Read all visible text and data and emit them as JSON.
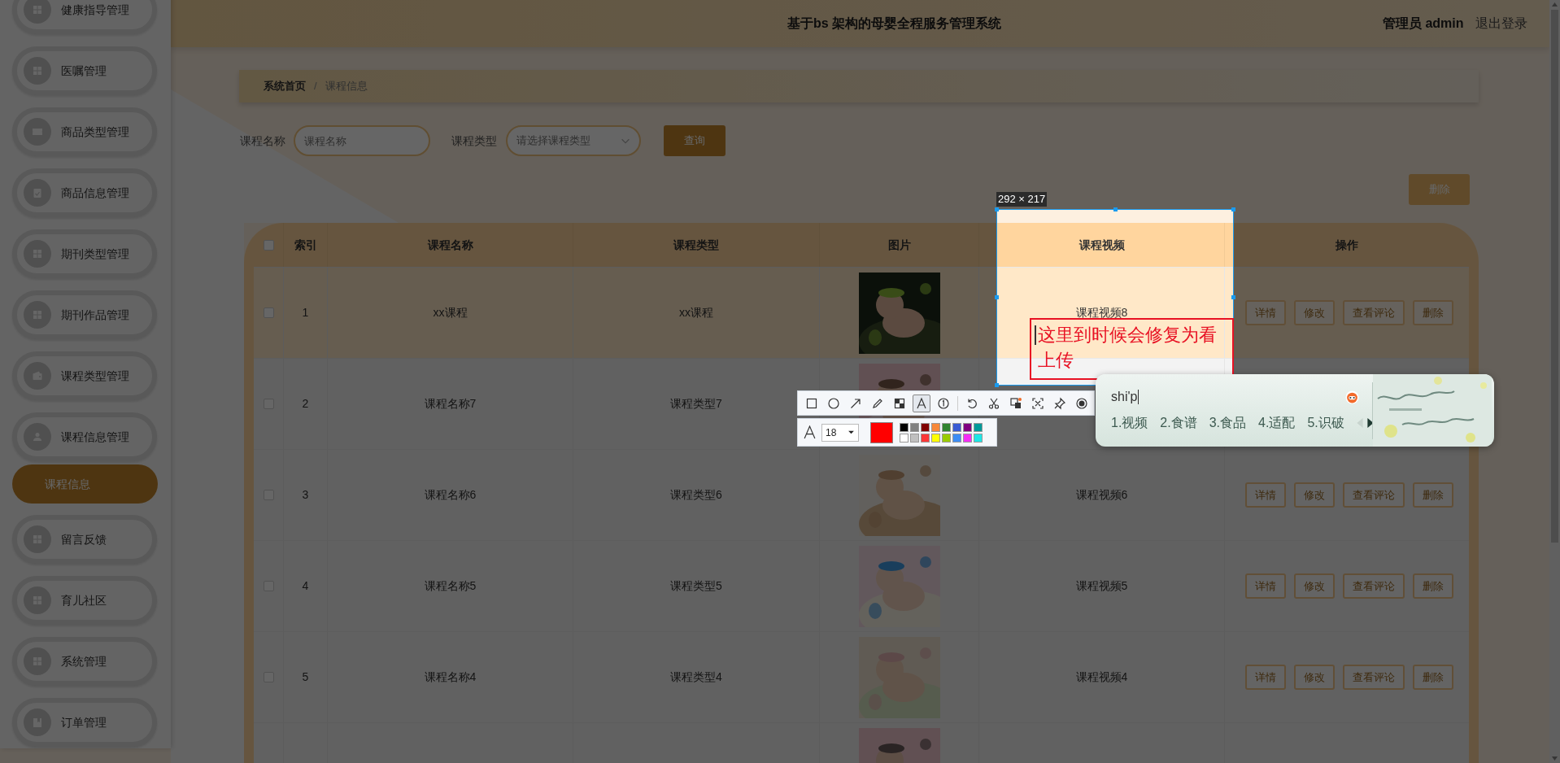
{
  "sidebar": {
    "items": [
      {
        "label": "健康指导管理"
      },
      {
        "label": "医嘱管理"
      },
      {
        "label": "商品类型管理"
      },
      {
        "label": "商品信息管理"
      },
      {
        "label": "期刊类型管理"
      },
      {
        "label": "期刊作品管理"
      },
      {
        "label": "课程类型管理"
      },
      {
        "label": "课程信息管理",
        "children": [
          {
            "label": "课程信息",
            "selected": true
          }
        ]
      },
      {
        "label": "留言反馈"
      },
      {
        "label": "育儿社区"
      },
      {
        "label": "系统管理"
      },
      {
        "label": "订单管理"
      }
    ]
  },
  "header": {
    "title": "基于bs 架构的母婴全程服务管理系统",
    "user": "管理员 admin",
    "logout": "退出登录"
  },
  "breadcrumb": {
    "items": [
      "系统首页",
      "课程信息"
    ],
    "separator": "/"
  },
  "search": {
    "fields": [
      {
        "label": "课程名称",
        "kind": "input",
        "placeholder": "课程名称"
      },
      {
        "label": "课程类型",
        "kind": "select",
        "placeholder": "请选择课程类型"
      }
    ],
    "button": "查询"
  },
  "delete_button": "删除",
  "table": {
    "select_all": {
      "checked": false
    },
    "columns": [
      "索引",
      "课程名称",
      "课程类型",
      "图片",
      "课程视频",
      "操作"
    ],
    "rows": [
      {
        "selected": true,
        "checked": false,
        "index": "1",
        "name": "xx课程",
        "type": "xx课程",
        "image": {
          "kind": "picture"
        },
        "video": "课程视频8",
        "actions": [
          "详情",
          "修改",
          "查看评论",
          "删除"
        ]
      },
      {
        "selected": false,
        "checked": false,
        "index": "2",
        "name": "课程名称7",
        "type": "课程类型7",
        "image": {
          "kind": "picture"
        }
      },
      {
        "selected": false,
        "checked": false,
        "index": "3",
        "name": "课程名称6",
        "type": "课程类型6",
        "image": {
          "kind": "picture"
        },
        "video": "课程视频6",
        "actions": [
          "详情",
          "修改",
          "查看评论",
          "删除"
        ]
      },
      {
        "selected": false,
        "checked": false,
        "index": "4",
        "name": "课程名称5",
        "type": "课程类型5",
        "image": {
          "kind": "picture"
        },
        "video": "课程视频5",
        "actions": [
          "详情",
          "修改",
          "查看评论",
          "删除"
        ]
      },
      {
        "selected": false,
        "checked": false,
        "index": "5",
        "name": "课程名称4",
        "type": "课程类型4",
        "image": {
          "kind": "picture"
        },
        "video": "课程视频4",
        "actions": [
          "详情",
          "修改",
          "查看评论",
          "删除"
        ]
      },
      {
        "selected": false,
        "image": {
          "kind": "picture"
        }
      }
    ]
  },
  "screenshot_tool": {
    "size_label": "292 × 217",
    "annotation": "这里到时候会修复为看上传",
    "tools": [
      {
        "selected": false
      },
      {
        "selected": false
      },
      {
        "selected": false
      },
      {
        "selected": false
      },
      {
        "selected": false
      },
      {
        "selected": true
      },
      {
        "selected": false
      },
      {
        "selected": false
      },
      {
        "selected": false
      },
      {
        "selected": false
      },
      {
        "selected": false
      },
      {
        "selected": false
      },
      {
        "selected": false
      }
    ],
    "font_size": "18",
    "palette": [
      {
        "color": "#000000"
      },
      {
        "color": "#808080"
      },
      {
        "color": "#800000"
      },
      {
        "color": "#f7883a"
      },
      {
        "color": "#308430"
      },
      {
        "color": "#385ad3"
      },
      {
        "color": "#800080"
      },
      {
        "color": "#009999"
      },
      {
        "color": "#ffffff"
      },
      {
        "color": "#c0c0c0"
      },
      {
        "color": "#fb3838"
      },
      {
        "color": "#ffff00"
      },
      {
        "color": "#99cc00"
      },
      {
        "color": "#3d8df5"
      },
      {
        "color": "#f52df5"
      },
      {
        "color": "#1ee6e6"
      }
    ]
  },
  "ime": {
    "composition": "shi'p",
    "candidates": [
      "1.视频",
      "2.食谱",
      "3.食品",
      "4.适配",
      "5.识破"
    ],
    "prev_page": {
      "disabled": true
    },
    "next_page": {
      "disabled": false
    }
  }
}
